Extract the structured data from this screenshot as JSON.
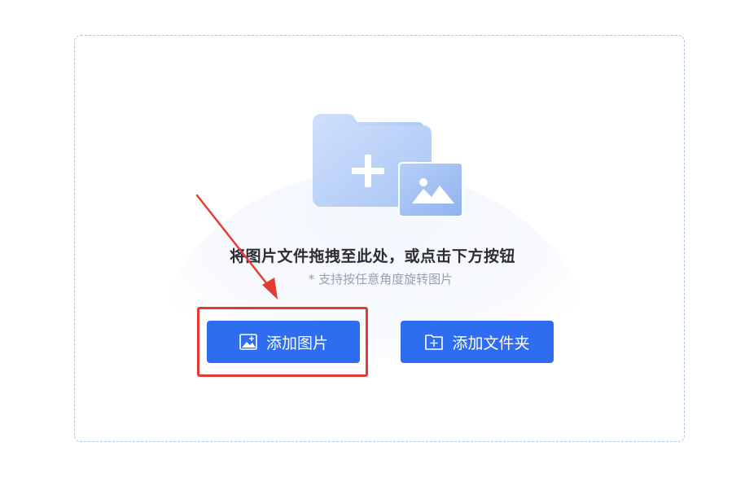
{
  "dropzone": {
    "main_hint": "将图片文件拖拽至此处，或点击下方按钮",
    "sub_hint": "* 支持按任意角度旋转图片"
  },
  "buttons": {
    "add_image_label": "添加图片",
    "add_folder_label": "添加文件夹"
  },
  "icons": {
    "illustration": "folder-with-image-icon",
    "add_image": "image-plus-icon",
    "add_folder": "folder-plus-icon"
  },
  "colors": {
    "primary": "#2e6cf0",
    "border": "#a9c6e8",
    "highlight": "#e43a32",
    "title": "#2d2d33",
    "muted": "#9aa0aa"
  }
}
